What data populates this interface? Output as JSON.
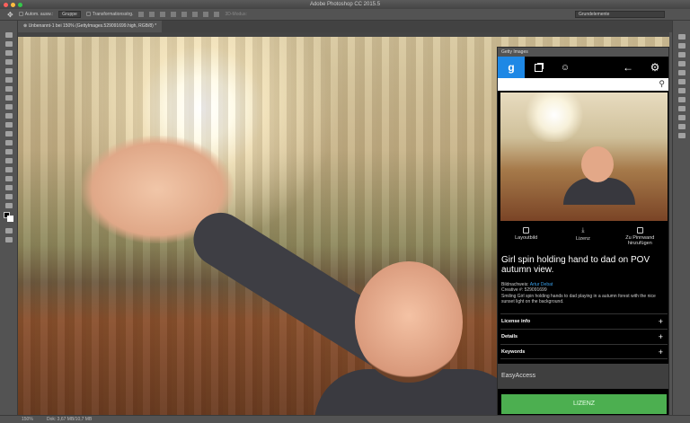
{
  "window": {
    "title": "Adobe Photoshop CC 2015.5"
  },
  "options": {
    "auto_select": "Autom. ausw.:",
    "group": "Gruppe",
    "transform": "Transformationsstrg.",
    "mode_3d": "3D-Modus:",
    "workspace": "Grundelemente"
  },
  "document": {
    "tab": "Unbenannt-1 bei 150% (GettyImages.529091699.high, RGB/8) *"
  },
  "status": {
    "zoom": "150%",
    "doc": "Dok: 3,67 MB/10,7 MB"
  },
  "getty": {
    "panel_title": "Getty Images",
    "nav": [
      {
        "icon": "getty-g-icon",
        "label": "g"
      },
      {
        "icon": "collections-icon"
      },
      {
        "icon": "user-icon"
      },
      {
        "icon": "back-arrow-icon",
        "label": "←"
      },
      {
        "icon": "gear-icon",
        "label": "⚙"
      }
    ],
    "actions": [
      {
        "icon": "layout-image-icon",
        "label": "Layoutbild"
      },
      {
        "icon": "download-icon",
        "label": "Lizenz"
      },
      {
        "icon": "add-board-icon",
        "label": "Zu Pinnwand hinzufügen"
      }
    ],
    "title": "Girl spin holding hand to dad on POV autumn view.",
    "credit_label": "Bildnachweis:",
    "credit_name": "Artur Debat",
    "creative": "Creative #: 529091699",
    "description": "Smiling Girl spin holding hands to dad playing in a autumn forest with the nice sunset light on the background.",
    "accordions": [
      "License info",
      "Details",
      "Keywords"
    ],
    "easyaccess": "EasyAccess",
    "license_button": "LIZENZ",
    "accent": "#1e88e5",
    "button_color": "#4caf50"
  }
}
